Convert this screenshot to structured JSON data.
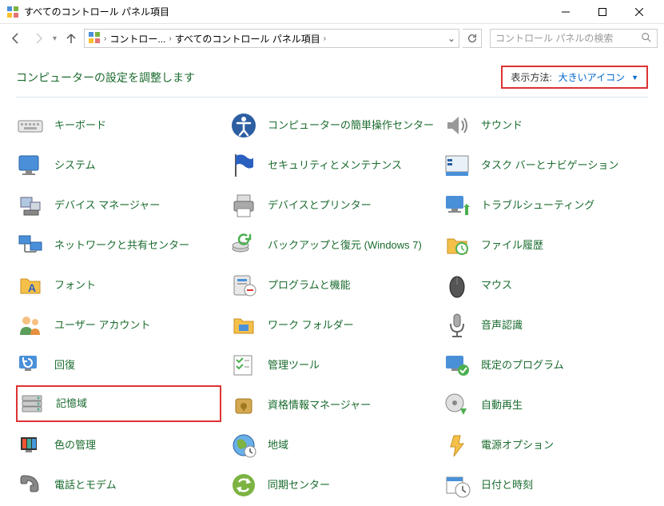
{
  "window": {
    "title": "すべてのコントロール パネル項目"
  },
  "breadcrumb": {
    "seg1": "コントロー...",
    "seg2": "すべてのコントロール パネル項目"
  },
  "search": {
    "placeholder": "コントロール パネルの検索"
  },
  "heading": "コンピューターの設定を調整します",
  "view": {
    "label": "表示方法:",
    "value": "大きいアイコン"
  },
  "items": {
    "r0c0": "キーボード",
    "r0c1": "コンピューターの簡単操作センター",
    "r0c2": "サウンド",
    "r1c0": "システム",
    "r1c1": "セキュリティとメンテナンス",
    "r1c2": "タスク バーとナビゲーション",
    "r2c0": "デバイス マネージャー",
    "r2c1": "デバイスとプリンター",
    "r2c2": "トラブルシューティング",
    "r3c0": "ネットワークと共有センター",
    "r3c1": "バックアップと復元 (Windows 7)",
    "r3c2": "ファイル履歴",
    "r4c0": "フォント",
    "r4c1": "プログラムと機能",
    "r4c2": "マウス",
    "r5c0": "ユーザー アカウント",
    "r5c1": "ワーク フォルダー",
    "r5c2": "音声認識",
    "r6c0": "回復",
    "r6c1": "管理ツール",
    "r6c2": "既定のプログラム",
    "r7c0": "記憶域",
    "r7c1": "資格情報マネージャー",
    "r7c2": "自動再生",
    "r8c0": "色の管理",
    "r8c1": "地域",
    "r8c2": "電源オプション",
    "r9c0": "電話とモデム",
    "r9c1": "同期センター",
    "r9c2": "日付と時刻"
  }
}
